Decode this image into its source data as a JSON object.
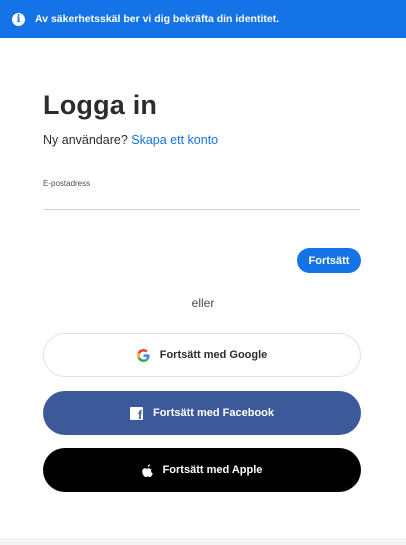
{
  "banner": {
    "icon": "info-icon",
    "text": "Av säkerhetsskäl ber vi dig bekräfta din identitet."
  },
  "signin": {
    "title": "Logga in",
    "new_user_text": "Ny användare?",
    "create_account_link": "Skapa ett konto",
    "email_label": "E-postadress",
    "email_value": "",
    "continue_label": "Fortsätt",
    "or_text": "eller"
  },
  "social": {
    "google_label": "Fortsätt med Google",
    "facebook_label": "Fortsätt med Facebook",
    "apple_label": "Fortsätt med Apple"
  },
  "colors": {
    "accent": "#1473e6",
    "facebook": "#3c5a99",
    "apple": "#000000"
  }
}
